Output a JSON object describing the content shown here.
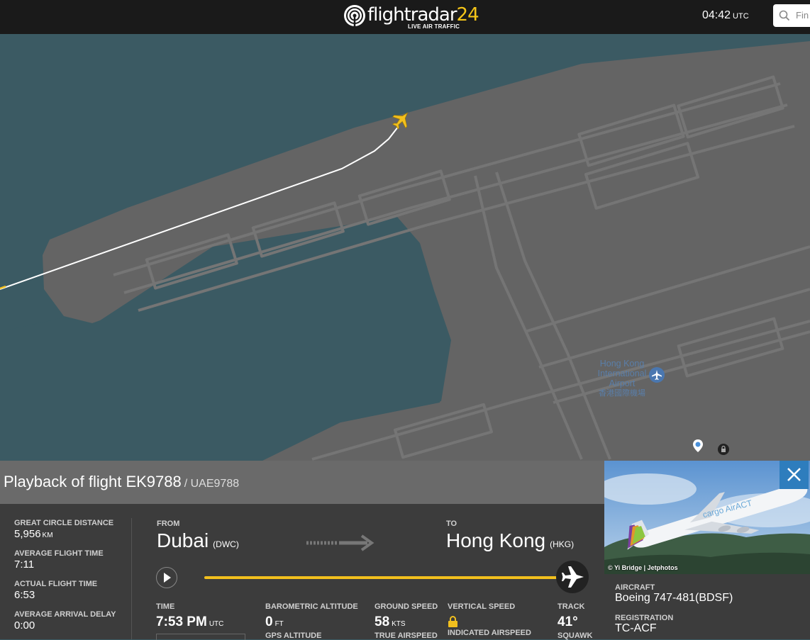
{
  "header": {
    "logo_main": "flightradar",
    "logo_num": "24",
    "logo_tagline": "LIVE AIR TRAFFIC",
    "clock_time": "04:42",
    "clock_tz": "UTC",
    "search_placeholder": "Fin",
    "search_icon": "search-icon"
  },
  "map": {
    "airport_name_en_1": "Hong Kong",
    "airport_name_en_2": "International",
    "airport_name_en_3": "Airport",
    "airport_name_cn": "香港國際機場",
    "airport_icon": "airplane-pin-icon",
    "colors": {
      "water": "#3b5a63",
      "land": "#646464",
      "taxiway": "#747474",
      "flight_path": "#ffffff",
      "aircraft": "#f2c01e"
    }
  },
  "flight": {
    "title_prefix": "Playback of flight",
    "flight_number": "EK9788",
    "callsign": "/ UAE9788"
  },
  "stats": {
    "gcd_label": "GREAT CIRCLE DISTANCE",
    "gcd_value": "5,956",
    "gcd_unit": "KM",
    "avg_time_label": "AVERAGE FLIGHT TIME",
    "avg_time_value": "7:11",
    "actual_time_label": "ACTUAL FLIGHT TIME",
    "actual_time_value": "6:53",
    "avg_delay_label": "AVERAGE ARRIVAL DELAY",
    "avg_delay_value": "0:00"
  },
  "route": {
    "from_label": "FROM",
    "from_city": "Dubai",
    "from_code": "(DWC)",
    "to_label": "TO",
    "to_city": "Hong Kong",
    "to_code": "(HKG)"
  },
  "playback": {
    "progress": 1.0,
    "accent_color": "#f2c01e"
  },
  "metrics": {
    "time_label": "TIME",
    "time_value": "7:53 PM",
    "time_unit": "UTC",
    "baro_label": "BAROMETRIC ALTITUDE",
    "baro_value": "0",
    "baro_unit": "FT",
    "gps_label": "GPS ALTITUDE",
    "gs_label": "GROUND SPEED",
    "gs_value": "58",
    "gs_unit": "KTS",
    "tas_label": "TRUE AIRSPEED",
    "vs_label": "VERTICAL SPEED",
    "ias_label": "INDICATED AIRSPEED",
    "track_label": "TRACK",
    "track_value": "41°",
    "squawk_label": "SQUAWK"
  },
  "aircraft": {
    "photo_credit": "© Yi Bridge | Jetphotos",
    "livery_text": "cargo AirACT",
    "aircraft_label": "AIRCRAFT",
    "aircraft_value": "Boeing 747-481(BDSF)",
    "registration_label": "REGISTRATION",
    "registration_value": "TC-ACF"
  }
}
